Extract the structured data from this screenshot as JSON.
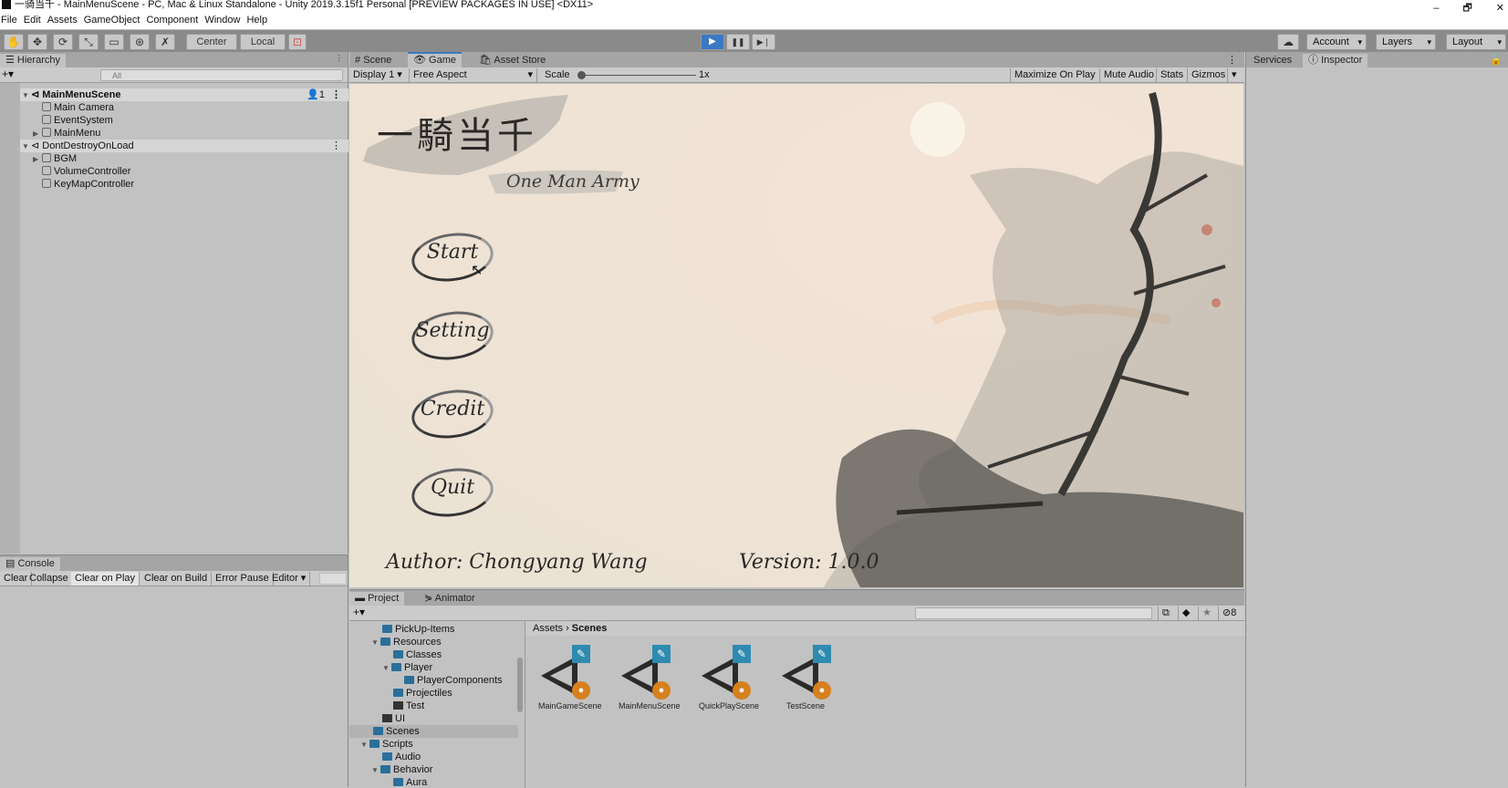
{
  "window": {
    "title": "一骑当千 - MainMenuScene - PC, Mac & Linux Standalone - Unity 2019.3.15f1 Personal [PREVIEW PACKAGES IN USE] <DX11>",
    "controls": [
      "–",
      "🗗",
      "✕"
    ]
  },
  "menu": [
    "File",
    "Edit",
    "Assets",
    "GameObject",
    "Component",
    "Window",
    "Help"
  ],
  "toolbar": {
    "tools": [
      "✋",
      "✥",
      "⟳",
      "⤡",
      "▭",
      "⊛",
      "✗"
    ],
    "pivot": "Center",
    "space": "Local",
    "play": "▶",
    "pause": "❚❚",
    "step": "▶❘",
    "account": "Account",
    "layers": "Layers",
    "layout": "Layout",
    "accent": "#3a79c4"
  },
  "hierarchy": {
    "tab": "Hierarchy",
    "search_placeholder": "All",
    "add": "+▾",
    "badge": "1",
    "items": [
      {
        "label": "MainMenuScene",
        "bold": true,
        "type": "scene",
        "expanded": true,
        "depth": 0
      },
      {
        "label": "Main Camera",
        "type": "go",
        "depth": 1
      },
      {
        "label": "EventSystem",
        "type": "go",
        "depth": 1
      },
      {
        "label": "MainMenu",
        "type": "go",
        "depth": 1,
        "collapsed": true
      },
      {
        "label": "DontDestroyOnLoad",
        "type": "scene",
        "expanded": true,
        "depth": 0
      },
      {
        "label": "BGM",
        "type": "go",
        "depth": 1,
        "collapsed": true
      },
      {
        "label": "VolumeController",
        "type": "go",
        "depth": 1
      },
      {
        "label": "KeyMapController",
        "type": "go",
        "depth": 1
      }
    ]
  },
  "console": {
    "tab": "Console",
    "buttons": [
      "Clear",
      "Collapse",
      "Clear on Play",
      "Clear on Build",
      "Error Pause",
      "Editor ▾"
    ]
  },
  "center": {
    "tabs": [
      "Scene",
      "Game",
      "Asset Store"
    ],
    "active": "Game",
    "display": "Display 1",
    "aspect": "Free Aspect",
    "scale_label": "Scale",
    "scale_value": "1x",
    "right_buttons": [
      "Maximize On Play",
      "Mute Audio",
      "Stats",
      "Gizmos"
    ]
  },
  "game": {
    "title_cn": "一騎当千",
    "subtitle": "One Man Army",
    "buttons": [
      "Start",
      "Setting",
      "Credit",
      "Quit"
    ],
    "author": "Author: Chongyang Wang",
    "version": "Version: 1.0.0"
  },
  "inspector": {
    "tabs": [
      "Services",
      "Inspector"
    ],
    "active": "Inspector"
  },
  "project": {
    "tabs": [
      "Project",
      "Animator"
    ],
    "add": "+▾",
    "hidden_count": "8",
    "tree": [
      {
        "label": "PickUp-Items",
        "depth": 2
      },
      {
        "label": "Resources",
        "depth": 1,
        "expanded": true
      },
      {
        "label": "Classes",
        "depth": 2
      },
      {
        "label": "Player",
        "depth": 2,
        "expanded": true
      },
      {
        "label": "PlayerComponents",
        "depth": 3
      },
      {
        "label": "Projectiles",
        "depth": 2
      },
      {
        "label": "Test",
        "depth": 2,
        "plain": true
      },
      {
        "label": "UI",
        "depth": 1,
        "plain": true
      },
      {
        "label": "Scenes",
        "depth": 0,
        "selected": true
      },
      {
        "label": "Scripts",
        "depth": 0,
        "expanded": true
      },
      {
        "label": "Audio",
        "depth": 1
      },
      {
        "label": "Behavior",
        "depth": 1,
        "expanded": true
      },
      {
        "label": "Aura",
        "depth": 2
      }
    ],
    "breadcrumb": [
      "Assets",
      "Scenes"
    ],
    "scenes": [
      "MainGameScene",
      "MainMenuScene",
      "QuickPlayScene",
      "TestScene"
    ]
  }
}
